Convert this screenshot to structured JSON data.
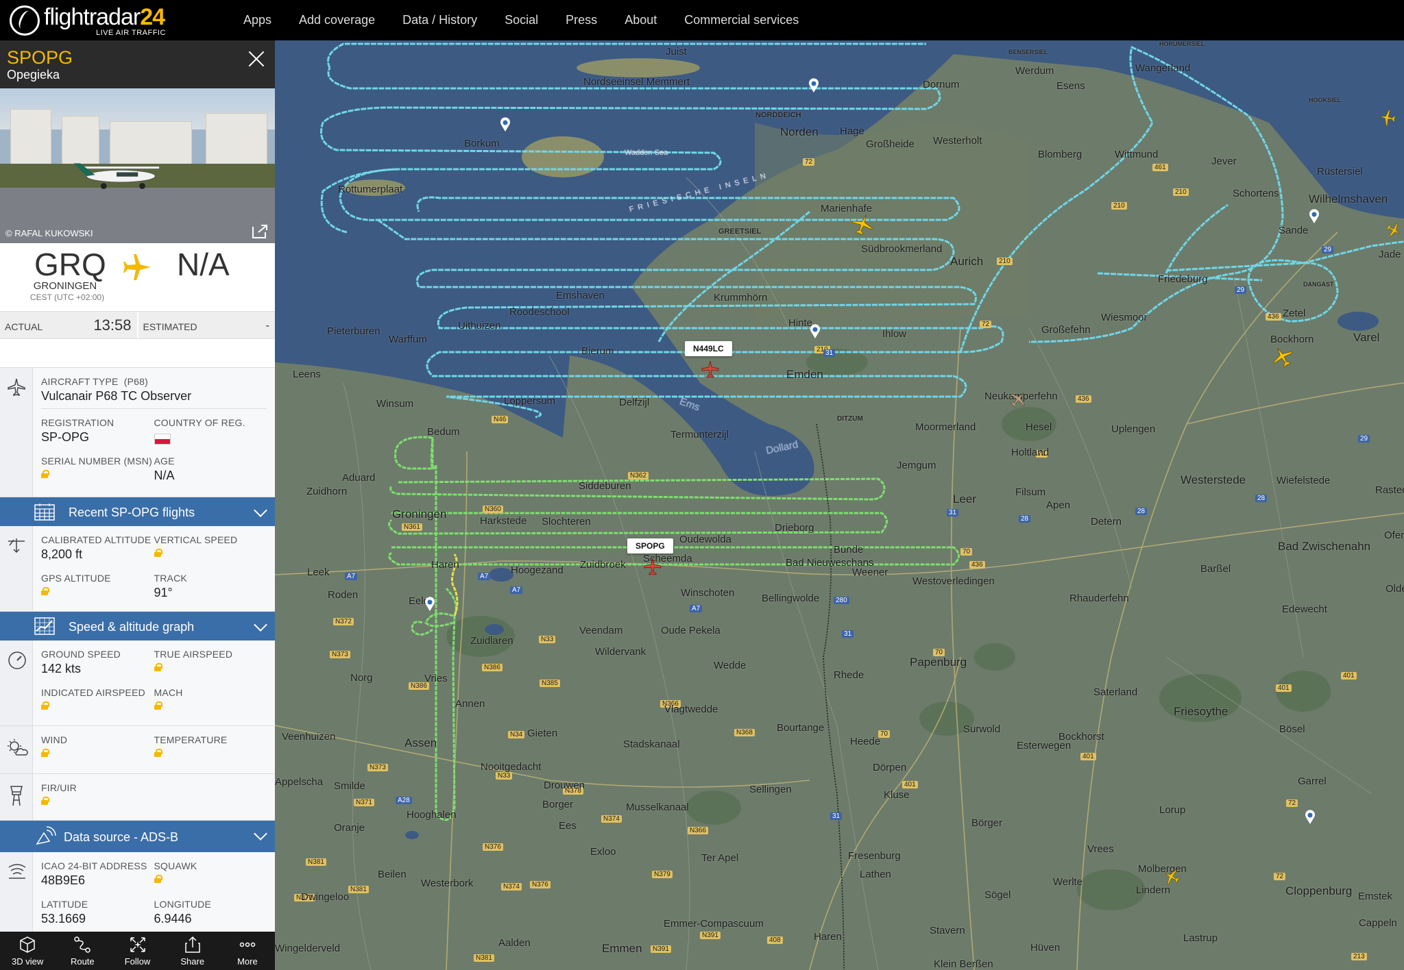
{
  "brand": {
    "name_a": "flightradar",
    "name_b": "24",
    "tagline": "LIVE AIR TRAFFIC"
  },
  "nav": [
    "Apps",
    "Add coverage",
    "Data / History",
    "Social",
    "Press",
    "About",
    "Commercial services"
  ],
  "flight": {
    "callsign": "SPOPG",
    "airline": "Opegieka",
    "photo_credit": "© RAFAL KUKOWSKI",
    "origin_code": "GRQ",
    "origin_city": "GRONINGEN",
    "origin_tz": "CEST (UTC +02:00)",
    "dest_code": "N/A",
    "actual_label": "ACTUAL",
    "actual_time": "13:58",
    "estimated_label": "ESTIMATED",
    "estimated_time": "-"
  },
  "aircraft": {
    "type_label": "AIRCRAFT TYPE",
    "type_code": "(P68)",
    "type_name": "Vulcanair P68 TC Observer",
    "reg_label": "REGISTRATION",
    "reg": "SP-OPG",
    "country_label": "COUNTRY OF REG.",
    "country_flag_colors": [
      "#ffffff",
      "#dc143c"
    ],
    "msn_label": "SERIAL NUMBER (MSN)",
    "age_label": "AGE",
    "age": "N/A"
  },
  "recent_bar": "Recent SP-OPG flights",
  "altitude": {
    "cal_label": "CALIBRATED ALTITUDE",
    "cal": "8,200 ft",
    "vs_label": "VERTICAL SPEED",
    "gps_label": "GPS ALTITUDE",
    "track_label": "TRACK",
    "track": "91°"
  },
  "graph_bar": "Speed & altitude graph",
  "speed": {
    "gs_label": "GROUND SPEED",
    "gs": "142 kts",
    "tas_label": "TRUE AIRSPEED",
    "ias_label": "INDICATED AIRSPEED",
    "mach_label": "MACH"
  },
  "weather": {
    "wind_label": "WIND",
    "temp_label": "TEMPERATURE"
  },
  "fir": {
    "label": "FIR/UIR"
  },
  "source_bar": "Data source - ADS-B",
  "transponder": {
    "icao_label": "ICAO 24-BIT ADDRESS",
    "icao": "48B9E6",
    "squawk_label": "SQUAWK",
    "lat_label": "LATITUDE",
    "lat": "53.1669",
    "lon_label": "LONGITUDE",
    "lon": "6.9446"
  },
  "bottom_actions": [
    "3D view",
    "Route",
    "Follow",
    "Share",
    "More"
  ],
  "map": {
    "aircraft_tags": [
      "N449LC",
      "SPOPG"
    ],
    "places": [
      "Juist",
      "Nordseeinsel Memmert",
      "Borkum",
      "Rottumerplaat",
      "Wadden Sea",
      "FRIESISCHE INSELN",
      "NORDDEICH",
      "Norden",
      "Hage",
      "Großheide",
      "Dornum",
      "Westerholt",
      "Werdum",
      "Esens",
      "Wangerland",
      "BENSERSIEL",
      "HORUMERSIEL",
      "HOOKSIEL",
      "Blomberg",
      "Wittmund",
      "Jever",
      "Rüstersiel",
      "Schortens",
      "Wilhelmshaven",
      "Sande",
      "Jade",
      "Friedeburg",
      "DANGAST",
      "Zetel",
      "Bockhorn",
      "Varel",
      "Marienhafe",
      "GREETSIEL",
      "Südbrookmerland",
      "Aurich",
      "Wiesmoor",
      "Großefehn",
      "Ihlow",
      "Hinte",
      "Krummhörn",
      "Emshaven",
      "Roodeschool",
      "Uithuizen",
      "Pieterburen",
      "Warffum",
      "Leens",
      "Bierum",
      "Emden",
      "Winsum",
      "Loppersum",
      "Delfzijl",
      "Ems",
      "Termunterzijl",
      "Dollard",
      "DITZUM",
      "Neukamperfehn",
      "Hesel",
      "Holtland",
      "Uplengen",
      "Moormerland",
      "Jemgum",
      "Leer",
      "Filsum",
      "Westerstede",
      "Wiefelstede",
      "Rastede",
      "Bedum",
      "Aduard",
      "Zuidhorn",
      "Groningen",
      "Harkstede",
      "Slochteren",
      "Siddeburen",
      "Drieborg",
      "Bunde",
      "Weener",
      "Apen",
      "Detern",
      "Bad Zwischenahn",
      "Ofen",
      "Oldenburg",
      "Haren",
      "Hoogezand",
      "Zuidbroek",
      "Scheemda",
      "Oudewolda",
      "Bad Nieuweschans",
      "Winschoten",
      "Westoverledingen",
      "Barßel",
      "Rhauderfehn",
      "Edewecht",
      "Leek",
      "Roden",
      "Eelde",
      "Bellingwolde",
      "Veendam",
      "Zuidlaren",
      "Oude Pekela",
      "Wildervank",
      "Wedde",
      "Papenburg",
      "Rhede",
      "Saterland",
      "Friesoythe",
      "Bösel",
      "Norg",
      "Vries",
      "Annen",
      "Vlagtwedde",
      "Bockhorst",
      "Surwold",
      "Esterwegen",
      "Veenhuizen",
      "Gieten",
      "Bourtange",
      "Heede",
      "Dörpen",
      "Assen",
      "Stadskanaal",
      "Nooitgedacht",
      "Sellingen",
      "Kluse",
      "Garrel",
      "Appelscha",
      "Smilde",
      "Drouwen",
      "Borger",
      "Musselkanaal",
      "Lorup",
      "Hooghalen",
      "Oranje",
      "Ees",
      "Börger",
      "Exloo",
      "Ter Apel",
      "Fresenburg",
      "Lathen",
      "Vrees",
      "Molbergen",
      "Lindern",
      "Cloppenburg",
      "Emstek",
      "Cappeln",
      "Beilen",
      "Westerbork",
      "Dwingeloo",
      "Sögel",
      "Werlte",
      "Wingelderveld",
      "Aalden",
      "Emmer-Compascuum",
      "Emmen",
      "Haren",
      "Stavern",
      "Lastrup",
      "Hüven",
      "Klein Berßen"
    ]
  }
}
